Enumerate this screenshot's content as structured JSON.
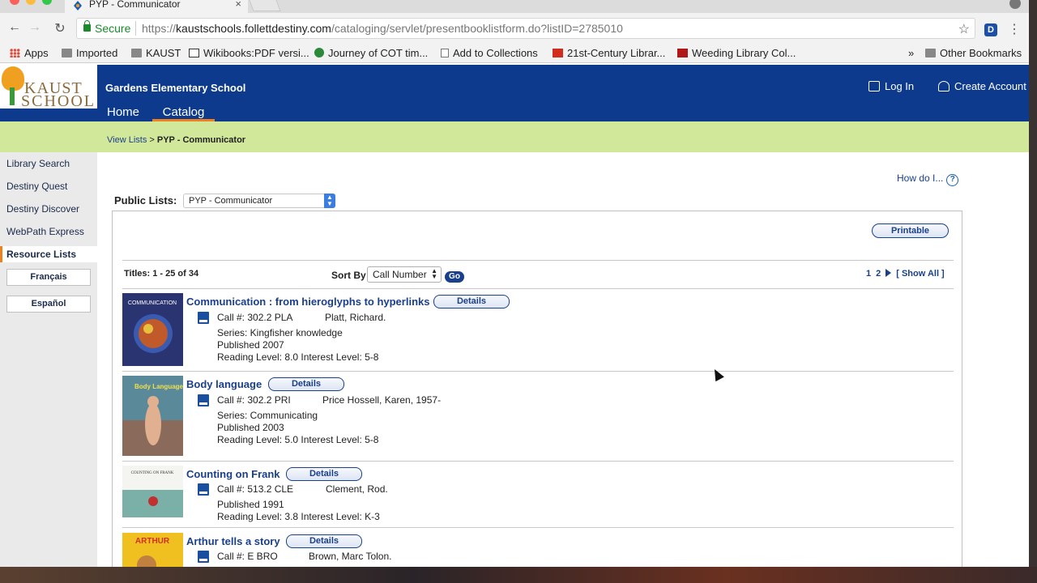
{
  "browser": {
    "tab_title": "PYP - Communicator",
    "tab_close": "×",
    "secure_label": "Secure",
    "url_scheme": "https://",
    "url_host": "kaustschools.follettdestiny.com",
    "url_path": "/cataloging/servlet/presentbooklistform.do?listID=2785010",
    "back_icon": "←",
    "forward_icon": "→",
    "reload_icon": "↻",
    "star_icon": "☆",
    "menu_icon": "⋮",
    "bookmarks": [
      "Apps",
      "Imported",
      "KAUST",
      "Wikibooks:PDF versi...",
      "Journey of COT tim...",
      "Add to Collections",
      "21st-Century Librar...",
      "Weeding Library Col..."
    ],
    "bookmarks_overflow": "»",
    "other_bookmarks": "Other Bookmarks"
  },
  "header": {
    "logo_line1": "KAUST",
    "logo_line2": "SCHOOL",
    "site_name": "Gardens Elementary School",
    "nav_home": "Home",
    "nav_catalog": "Catalog",
    "login": "Log In",
    "create_account": "Create Account"
  },
  "breadcrumb": {
    "link": "View Lists",
    "separator": " > ",
    "current": "PYP - Communicator"
  },
  "sidebar": {
    "items": [
      "Library Search",
      "Destiny Quest",
      "Destiny Discover",
      "WebPath Express"
    ],
    "active": "Resource Lists",
    "lang1": "Français",
    "lang2": "Español"
  },
  "main": {
    "how_do_i": "How do I...",
    "help_glyph": "?",
    "public_lists_label": "Public Lists:",
    "public_list_selected": "PYP - Communicator",
    "printable": "Printable",
    "titles_count": "Titles: 1 - 25 of 34",
    "sort_by_label": "Sort By",
    "sort_selected": "Call Number",
    "go": "Go",
    "pages": [
      "1",
      "2"
    ],
    "show_all": "[ Show All ]",
    "details_label": "Details"
  },
  "books": [
    {
      "title": "Communication : from hieroglyphs to hyperlinks",
      "call": "Call #: 302.2 PLA",
      "author": "Platt, Richard.",
      "series": "Series: Kingfisher knowledge",
      "published": "Published 2007",
      "levels": "Reading Level: 8.0  Interest Level: 5-8",
      "cover_text": "COMMUNICATION",
      "cover_color": "#2a3470"
    },
    {
      "title": "Body language",
      "call": "Call #: 302.2 PRI",
      "author": "Price Hossell, Karen, 1957-",
      "series": "Series: Communicating",
      "published": "Published 2003",
      "levels": "Reading Level: 5.0  Interest Level: 5-8",
      "cover_text": "Body Language",
      "cover_color": "#5a8a9a"
    },
    {
      "title": "Counting on Frank",
      "call": "Call #: 513.2 CLE",
      "author": "Clement, Rod.",
      "series": "",
      "published": "Published 1991",
      "levels": "Reading Level: 3.8  Interest Level: K-3",
      "cover_text": "COUNTING ON FRANK",
      "cover_color": "#7ab0a8"
    },
    {
      "title": "Arthur tells a story",
      "call": "Call #: E BRO",
      "author": "Brown, Marc Tolon.",
      "series": "",
      "published": "",
      "levels": "",
      "cover_text": "ARTHUR",
      "cover_color": "#f0c020"
    }
  ]
}
